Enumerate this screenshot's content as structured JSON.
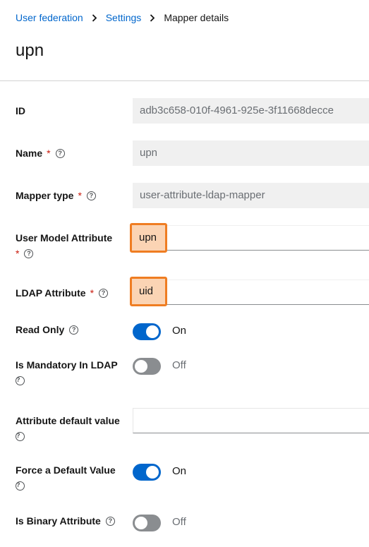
{
  "breadcrumb": {
    "items": [
      "User federation",
      "Settings"
    ],
    "current": "Mapper details"
  },
  "title": "upn",
  "fields": {
    "id": {
      "label": "ID",
      "value": "adb3c658-010f-4961-925e-3f11668decce"
    },
    "name": {
      "label": "Name",
      "required": "*",
      "value": "upn"
    },
    "mapper_type": {
      "label": "Mapper type",
      "required": "*",
      "value": "user-attribute-ldap-mapper"
    },
    "user_model_attribute": {
      "label": "User Model Attribute",
      "required": "*",
      "value": "upn"
    },
    "ldap_attribute": {
      "label": "LDAP Attribute",
      "required": "*",
      "value": "uid"
    },
    "read_only": {
      "label": "Read Only",
      "state": "On"
    },
    "is_mandatory": {
      "label": "Is Mandatory In LDAP",
      "state": "Off"
    },
    "attribute_default": {
      "label": "Attribute default value",
      "value": ""
    },
    "force_default": {
      "label": "Force a Default Value",
      "state": "On"
    },
    "is_binary": {
      "label": "Is Binary Attribute",
      "state": "Off"
    }
  },
  "help_icon": "?",
  "colors": {
    "link": "#0066cc",
    "toggle_on": "#0066cc",
    "toggle_off": "#8a8d90",
    "required": "#c9190b",
    "highlight": "#ef7d22"
  }
}
